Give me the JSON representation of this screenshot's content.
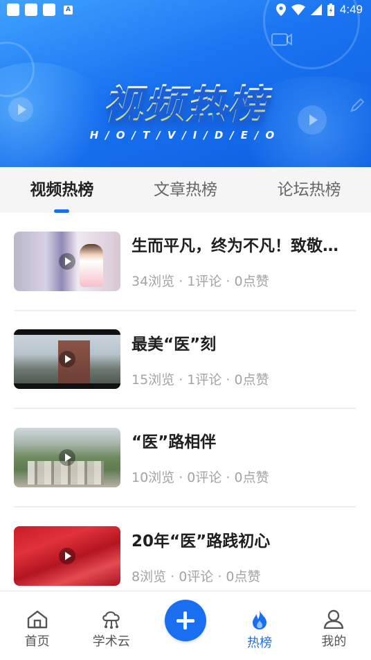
{
  "status_bar": {
    "time": "4:49",
    "icons": [
      "notification-icon",
      "notification-icon",
      "notification-icon",
      "app-a-icon",
      "location-icon",
      "wifi-icon",
      "signal-icon",
      "battery-icon"
    ]
  },
  "banner": {
    "title": "视频热榜",
    "subtitle": "H/O/T/V/I/D/E/O"
  },
  "tabs": [
    {
      "label": "视频热榜",
      "active": true
    },
    {
      "label": "文章热榜",
      "active": false
    },
    {
      "label": "论坛热榜",
      "active": false
    }
  ],
  "items": [
    {
      "title": "生而平凡，终为不凡！致敬…",
      "meta": "34浏览 · 1评论 · 0点赞"
    },
    {
      "title": "最美“医”刻",
      "meta": "15浏览 · 1评论 · 0点赞"
    },
    {
      "title": "“医”路相伴",
      "meta": "10浏览 · 0评论 · 0点赞"
    },
    {
      "title": "20年“医”路践初心",
      "meta": "8浏览 · 0评论 · 0点赞"
    }
  ],
  "nav": {
    "home": "首页",
    "cloud": "学术云",
    "hot": "热榜",
    "mine": "我的"
  },
  "colors": {
    "accent": "#1a6ff0",
    "banner_start": "#3fa2ff",
    "banner_end": "#0d5fe0"
  }
}
